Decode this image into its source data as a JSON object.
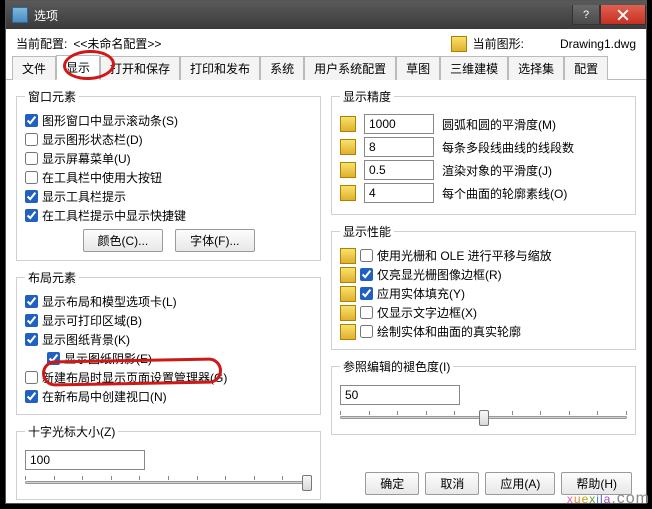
{
  "window": {
    "title": "选项"
  },
  "topbar": {
    "currentConfigLabel": "当前配置:",
    "currentConfigValue": "<<未命名配置>>",
    "currentDrawingLabel": "当前图形:",
    "currentDrawingValue": "Drawing1.dwg"
  },
  "tabs": [
    "文件",
    "显示",
    "打开和保存",
    "打印和发布",
    "系统",
    "用户系统配置",
    "草图",
    "三维建模",
    "选择集",
    "配置"
  ],
  "activeTab": 1,
  "winElements": {
    "legend": "窗口元素",
    "items": [
      {
        "checked": true,
        "label": "图形窗口中显示滚动条(S)"
      },
      {
        "checked": false,
        "label": "显示图形状态栏(D)"
      },
      {
        "checked": false,
        "label": "显示屏幕菜单(U)"
      },
      {
        "checked": false,
        "label": "在工具栏中使用大按钮"
      },
      {
        "checked": true,
        "label": "显示工具栏提示"
      },
      {
        "checked": true,
        "label": "在工具栏提示中显示快捷键"
      }
    ],
    "colorBtn": "颜色(C)...",
    "fontBtn": "字体(F)..."
  },
  "layoutElements": {
    "legend": "布局元素",
    "items": [
      {
        "checked": true,
        "label": "显示布局和模型选项卡(L)"
      },
      {
        "checked": true,
        "label": "显示可打印区域(B)"
      },
      {
        "checked": true,
        "label": "显示图纸背景(K)"
      },
      {
        "checked": true,
        "label": "显示图纸阴影(E)",
        "indent": true
      },
      {
        "checked": false,
        "label": "新建布局时显示页面设置管理器(G)"
      },
      {
        "checked": true,
        "label": "在新布局中创建视口(N)"
      }
    ]
  },
  "precision": {
    "legend": "显示精度",
    "rows": [
      {
        "value": "1000",
        "label": "圆弧和圆的平滑度(M)"
      },
      {
        "value": "8",
        "label": "每条多段线曲线的线段数"
      },
      {
        "value": "0.5",
        "label": "渲染对象的平滑度(J)"
      },
      {
        "value": "4",
        "label": "每个曲面的轮廓素线(O)"
      }
    ]
  },
  "performance": {
    "legend": "显示性能",
    "items": [
      {
        "checked": false,
        "label": "使用光栅和 OLE 进行平移与缩放"
      },
      {
        "checked": true,
        "label": "仅亮显光栅图像边框(R)"
      },
      {
        "checked": true,
        "label": "应用实体填充(Y)"
      },
      {
        "checked": false,
        "label": "仅显示文字边框(X)"
      },
      {
        "checked": false,
        "label": "绘制实体和曲面的真实轮廓"
      }
    ]
  },
  "crosshair": {
    "legend": "十字光标大小(Z)",
    "value": "100"
  },
  "refEdit": {
    "legend": "参照编辑的褪色度(I)",
    "value": "50"
  },
  "footer": {
    "ok": "确定",
    "cancel": "取消",
    "apply": "应用(A)",
    "help": "帮助(H)"
  }
}
